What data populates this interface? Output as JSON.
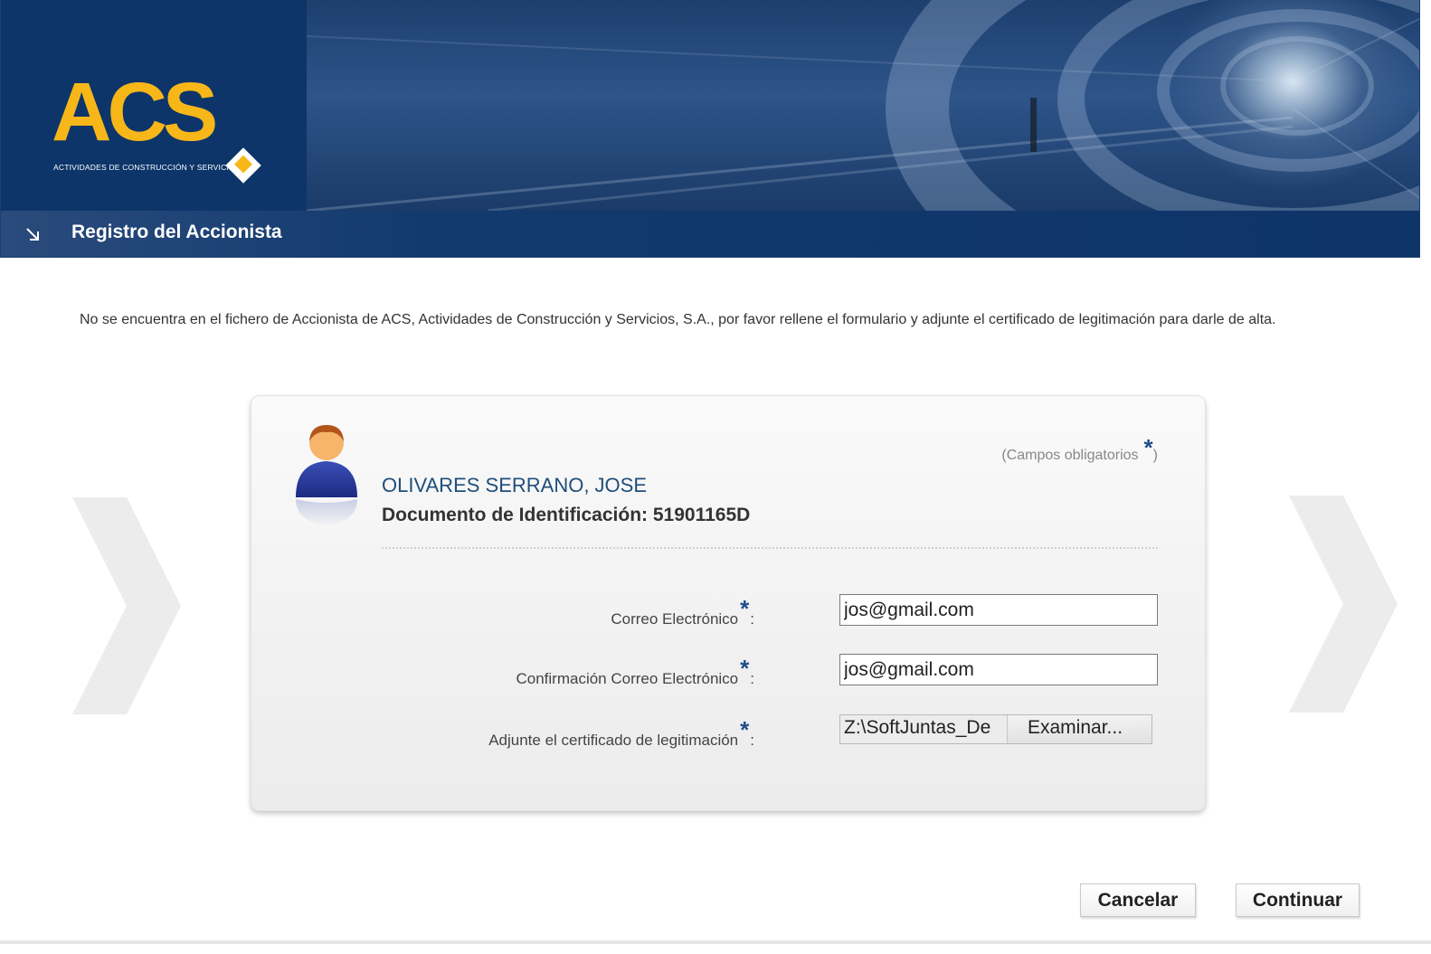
{
  "header": {
    "logo_text": "ACS",
    "logo_subtitle": "ACTIVIDADES DE CONSTRUCCIÓN Y SERVICIOS",
    "page_title": "Registro del Accionista"
  },
  "intro_text": "No se encuentra en el fichero de Accionista de ACS, Actividades de Construcción y Servicios, S.A., por favor rellene el formulario y adjunte el certificado de legitimación para darle de alta.",
  "form": {
    "required_note": "(Campos obligatorios",
    "required_note_close": ")",
    "required_star": "*",
    "person_name": "OLIVARES SERRANO, JOSE",
    "document_id": "Documento de Identificación: 51901165D",
    "fields": [
      {
        "label": "Correo Electrónico",
        "value": "jos@gmail.com"
      },
      {
        "label": "Confirmación Correo Electrónico",
        "value": "jos@gmail.com"
      },
      {
        "label": "Adjunte el certificado de legitimación",
        "value": "Z:\\SoftJuntas_De",
        "button": "Examinar..."
      }
    ],
    "colon": ":"
  },
  "buttons": {
    "cancel": "Cancelar",
    "continue": "Continuar"
  },
  "colors": {
    "brand_blue": "#0e3468",
    "brand_yellow": "#f7b719",
    "name_blue": "#1f4e7a"
  }
}
